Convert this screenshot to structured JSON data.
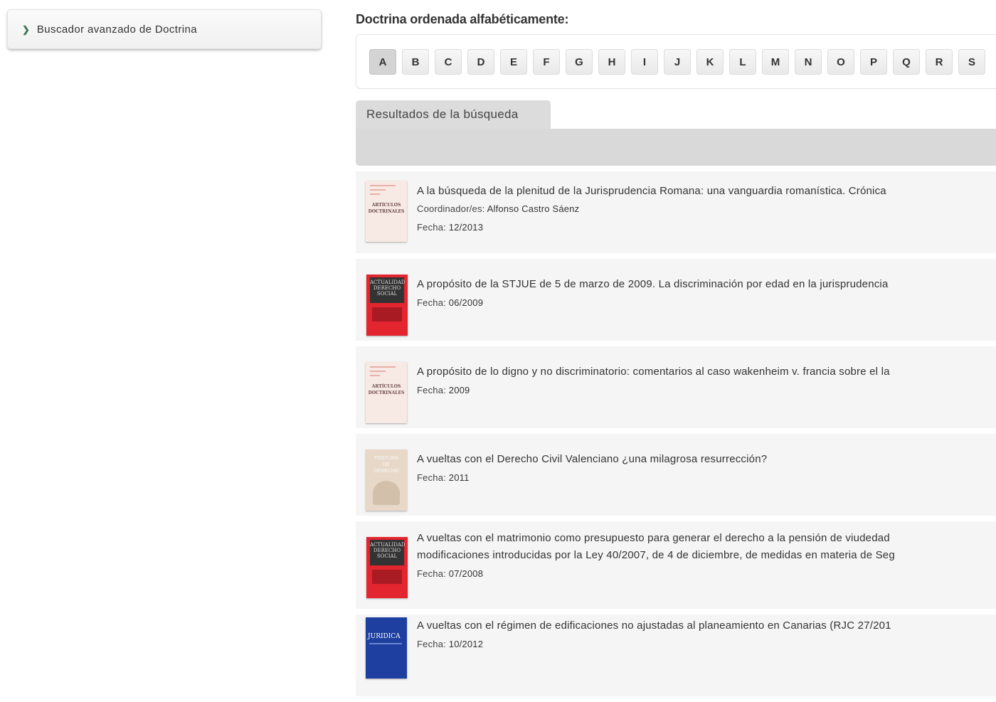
{
  "sidebar": {
    "link_label": "Buscador avanzado de Doctrina"
  },
  "heading": "Doctrina ordenada alfabéticamente:",
  "alphabet": [
    "A",
    "B",
    "C",
    "D",
    "E",
    "F",
    "G",
    "H",
    "I",
    "J",
    "K",
    "L",
    "M",
    "N",
    "O",
    "P",
    "Q",
    "R",
    "S"
  ],
  "alphabet_active": "A",
  "results_tab": "Resultados de la búsqueda",
  "meta_labels": {
    "coordinator": "Coordinador/es:",
    "date": "Fecha:"
  },
  "thumb_texts": {
    "articulos": "ARTÍCULOS DOCTRINALES",
    "juridica": "JURIDICA"
  },
  "results": [
    {
      "title": "A la búsqueda de la plenitud de la Jurisprudencia Romana: una vanguardia romanística. Crónica",
      "coordinator": "Alfonso Castro Sáenz",
      "date": "12/2013",
      "thumb": "articulos-doctrinales-cover"
    },
    {
      "title": "A propósito de la STJUE de 5 de marzo de 2009. La discriminación por edad en la jurisprudencia",
      "date": "06/2009",
      "thumb": "red-journal-cover"
    },
    {
      "title": "A propósito de lo digno y no discriminatorio: comentarios al caso wakenheim v. francia sobre el la",
      "date": "2009",
      "thumb": "articulos-doctrinales-cover"
    },
    {
      "title": "A vueltas con el Derecho Civil Valenciano ¿una milagrosa resurrección?",
      "date": "2011",
      "thumb": "beige-book-cover"
    },
    {
      "title": "A vueltas con el matrimonio como presupuesto para generar el derecho a la pensión de viudedad",
      "title_line2": "modificaciones introducidas por la Ley 40/2007, de 4 de diciembre, de medidas en materia de Seg",
      "date": "07/2008",
      "thumb": "red-journal-cover"
    },
    {
      "title": "A vueltas con el régimen de edificaciones no ajustadas al planeamiento en Canarias (RJC 27/201",
      "date": "10/2012",
      "thumb": "blue-journal-cover"
    }
  ],
  "colors": {
    "accent_green": "#3d7a57",
    "tab_gray": "#dcdcdc",
    "row_bg": "#f5f5f5"
  }
}
